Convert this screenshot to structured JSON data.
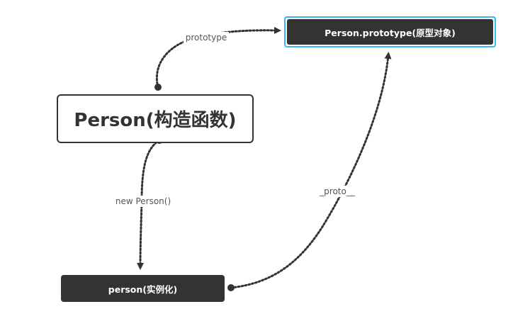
{
  "nodes": {
    "prototype": {
      "label": "Person.prototype(原型对象)"
    },
    "constructor": {
      "label": "Person(构造函数)"
    },
    "instance": {
      "label": "person(实例化)"
    }
  },
  "edges": {
    "prototype_link": {
      "label": "prototype"
    },
    "new_link": {
      "label": "new Person()"
    },
    "proto_link": {
      "label": "_proto__"
    }
  },
  "colors": {
    "node_dark": "#333333",
    "node_light": "#ffffff",
    "selection_outline": "#3bb6e8",
    "edge": "#333333",
    "edge_label": "#555555"
  }
}
